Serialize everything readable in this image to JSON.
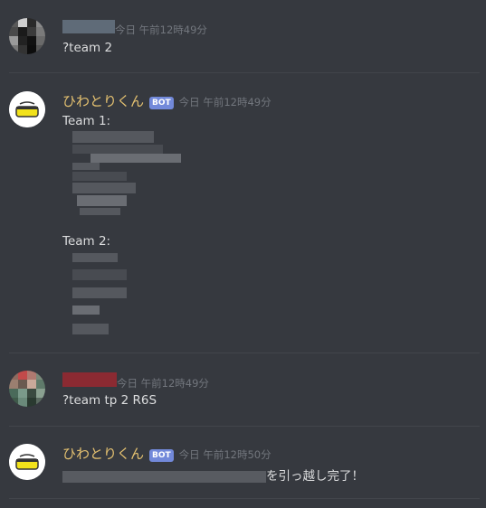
{
  "messages": [
    {
      "timestamp": "今日 午前12時49分",
      "text": "?team 2"
    },
    {
      "username": "ひわとりくん",
      "badge": "BOT",
      "timestamp": "今日 午前12時49分",
      "team1_label": "Team 1:",
      "team2_label": "Team 2:"
    },
    {
      "timestamp": "今日 午前12時49分",
      "text": "?team tp 2 R6S"
    },
    {
      "username": "ひわとりくん",
      "badge": "BOT",
      "timestamp": "今日 午前12時50分",
      "text_suffix": "を引っ越し完了！"
    }
  ],
  "colors": {
    "background": "#36393f",
    "bot_username": "#e3c070",
    "bot_badge": "#7289da",
    "timestamp": "#72767d"
  }
}
